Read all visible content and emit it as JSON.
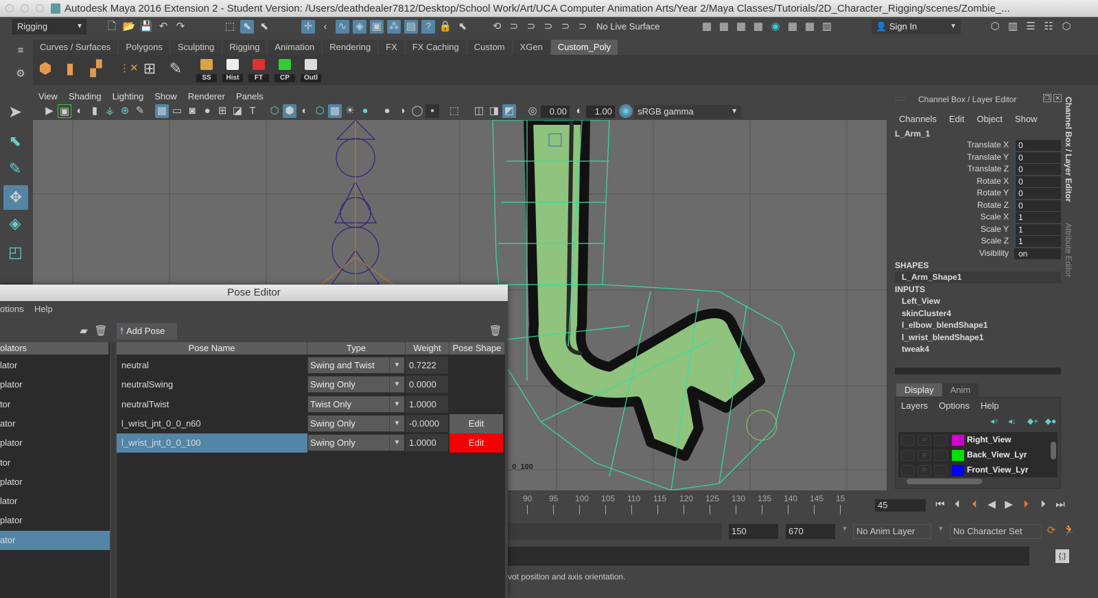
{
  "window_title": "Autodesk Maya 2016 Extension 2 - Student Version: /Users/deathdealer7812/Desktop/School Work/Art/UCA Computer Animation Arts/Year 2/Maya Classes/Tutorials/2D_Character_Rigging/scenes/Zombie_...",
  "statusline": {
    "menu_set": "Rigging",
    "live_surface": "No Live Surface",
    "sign_in": "Sign In"
  },
  "shelf": {
    "tabs": [
      "Curves / Surfaces",
      "Polygons",
      "Sculpting",
      "Rigging",
      "Animation",
      "Rendering",
      "FX",
      "FX Caching",
      "Custom",
      "XGen",
      "Custom_Poly"
    ],
    "active_tab": "Custom_Poly",
    "buttons": [
      "SS",
      "Hist",
      "FT",
      "CP",
      "Outl"
    ]
  },
  "viewport": {
    "menu": [
      "View",
      "Shading",
      "Lighting",
      "Show",
      "Renderer",
      "Panels"
    ],
    "exposure": "0.00",
    "gamma": "1.00",
    "color_space": "sRGB gamma",
    "hud_label": "_0_100"
  },
  "channel_box": {
    "title": "Channel Box / Layer Editor",
    "menu": [
      "Channels",
      "Edit",
      "Object",
      "Show"
    ],
    "object": "L_Arm_1",
    "channels": [
      {
        "name": "Translate X",
        "value": "0"
      },
      {
        "name": "Translate Y",
        "value": "0"
      },
      {
        "name": "Translate Z",
        "value": "0"
      },
      {
        "name": "Rotate X",
        "value": "0"
      },
      {
        "name": "Rotate Y",
        "value": "0"
      },
      {
        "name": "Rotate Z",
        "value": "0"
      },
      {
        "name": "Scale X",
        "value": "1"
      },
      {
        "name": "Scale Y",
        "value": "1"
      },
      {
        "name": "Scale Z",
        "value": "1"
      },
      {
        "name": "Visibility",
        "value": "on"
      }
    ],
    "shapes_header": "SHAPES",
    "shapes": [
      "L_Arm_Shape1"
    ],
    "inputs_header": "INPUTS",
    "inputs": [
      "Left_View",
      "skinCluster4",
      "l_elbow_blendShape1",
      "l_wrist_blendShape1",
      "tweak4"
    ]
  },
  "layer_editor": {
    "tabs": [
      "Display",
      "Anim"
    ],
    "menu": [
      "Layers",
      "Options",
      "Help"
    ],
    "layers": [
      {
        "name": "Right_View",
        "color": "#d000d0",
        "p": "P"
      },
      {
        "name": "Back_View_Lyr",
        "color": "#00e000",
        "p": "P"
      },
      {
        "name": "Front_View_Lyr",
        "color": "#0000ff",
        "p": "P"
      }
    ]
  },
  "side_tabs": [
    "Channel Box / Layer Editor",
    "Attribute Editor"
  ],
  "timeline": {
    "ticks": [
      "90",
      "95",
      "100",
      "105",
      "110",
      "115",
      "120",
      "125",
      "130",
      "135",
      "140",
      "145",
      "15"
    ],
    "current_frame": "45",
    "range_end": "150",
    "anim_end": "670",
    "anim_layer": "No Anim Layer",
    "character_set": "No Character Set"
  },
  "help_line": "vot position and axis orientation.",
  "pose_editor": {
    "title": "Pose Editor",
    "menu": [
      "otions",
      "Help"
    ],
    "left_header": "olators",
    "left_items": [
      "lator",
      "plator",
      "tor",
      "ator",
      "plator",
      "tor",
      "plator",
      "lator",
      "plator",
      "ator"
    ],
    "left_selected_index": 9,
    "add_pose": "Add Pose",
    "columns": [
      "Pose Name",
      "Type",
      "Weight",
      "Pose Shape"
    ],
    "poses": [
      {
        "name": "neutral",
        "type": "Swing and Twist",
        "weight": "0.7222",
        "edit": ""
      },
      {
        "name": "neutralSwing",
        "type": "Swing Only",
        "weight": "0.0000",
        "edit": ""
      },
      {
        "name": "neutralTwist",
        "type": "Twist Only",
        "weight": "1.0000",
        "edit": ""
      },
      {
        "name": "l_wrist_jnt_0_0_n60",
        "type": "Swing Only",
        "weight": "-0.0000",
        "edit": "Edit"
      },
      {
        "name": "l_wrist_jnt_0_0_100",
        "type": "Swing Only",
        "weight": "1.0000",
        "edit": "Edit"
      }
    ]
  }
}
